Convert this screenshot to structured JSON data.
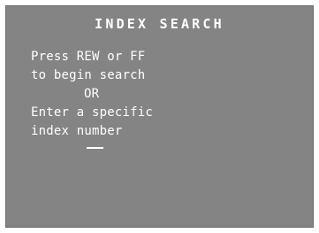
{
  "screen": {
    "title": "INDEX SEARCH",
    "line1": "Press REW or FF",
    "line2": "to begin search",
    "line3": "OR",
    "line4": "Enter a specific",
    "line5": "index number",
    "entry_value": "__"
  },
  "colors": {
    "screen_background": "#848484",
    "text": "#ffffff"
  }
}
